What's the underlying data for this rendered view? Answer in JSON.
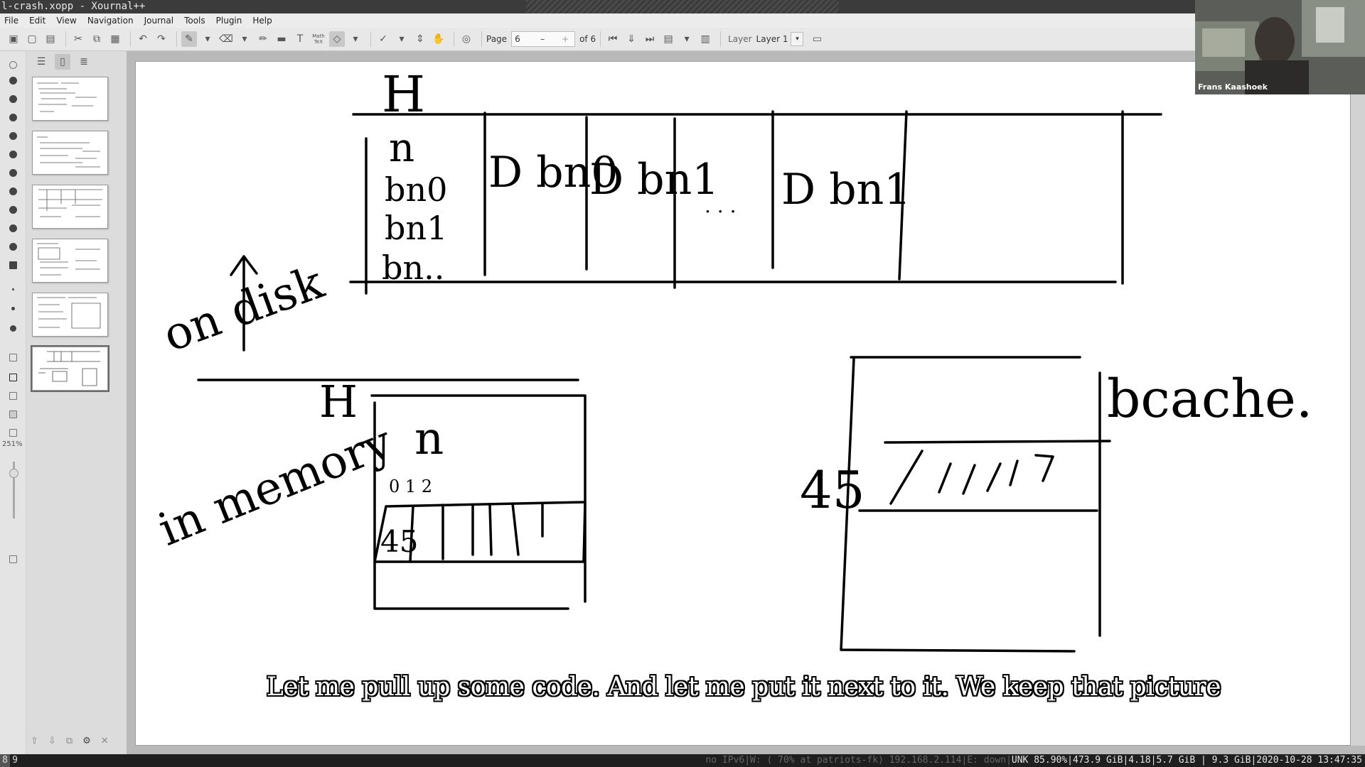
{
  "window": {
    "title": "l-crash.xopp - Xournal++"
  },
  "menu": [
    "File",
    "Edit",
    "View",
    "Navigation",
    "Journal",
    "Tools",
    "Plugin",
    "Help"
  ],
  "toolbar": {
    "page_label": "Page",
    "page_value": "6",
    "page_of": "of 6",
    "layer_label": "Layer",
    "layer_value": "Layer 1",
    "math_tex_label": "Math TeX"
  },
  "toolcol": {
    "zoom": "251%"
  },
  "webcam": {
    "name": "Frans Kaashoek"
  },
  "canvas": {
    "labels": {
      "top_h": "H",
      "inode_n": "n",
      "bn0": "bn0",
      "bn1": "bn1",
      "bn_dots": "bn..",
      "d_bn0": "D bn0",
      "d_bn1": "D bn1",
      "ellipsis": ". . .",
      "d_bn_last": "D bn1",
      "on_disk": "on disk",
      "in_memory": "in memory",
      "mem_h": "H",
      "mem_n": "n",
      "index_labels": "0 1 2",
      "cell_45": "45",
      "cache_45": "45",
      "cache_slashes": "/ / / / / 7",
      "bcache": "bcache."
    }
  },
  "subtitle": "Let me pull up some code. And let me put it next to it. We keep that picture",
  "statusbar": {
    "workspaces": [
      "8",
      "9"
    ],
    "network_dim": "no IPv6|W: ( 70% at patriots-fk) 192.168.2.114|E: down|",
    "stats": "UNK 85.90%|473.9 GiB|4.18|5.7 GiB | 9.3 GiB|2020-10-28 13:47:35"
  }
}
